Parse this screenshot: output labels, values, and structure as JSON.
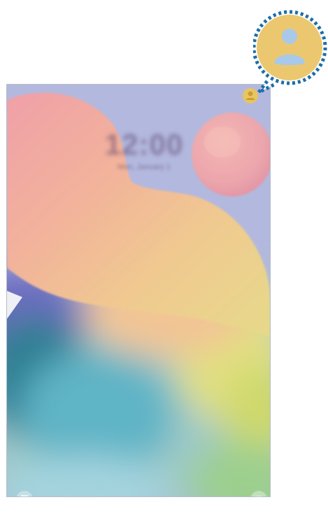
{
  "lockscreen": {
    "clock": "12:00",
    "date": "Mon, January 1",
    "icons": {
      "user_icon": "user-icon",
      "left_shortcut_icon": "note-icon",
      "right_shortcut_icon": "camera-icon"
    }
  },
  "callout": {
    "icon": "user-icon",
    "colors": {
      "fill": "#ebc86f",
      "dots": "#1c6ea8",
      "person": "#a8c9ea"
    }
  }
}
